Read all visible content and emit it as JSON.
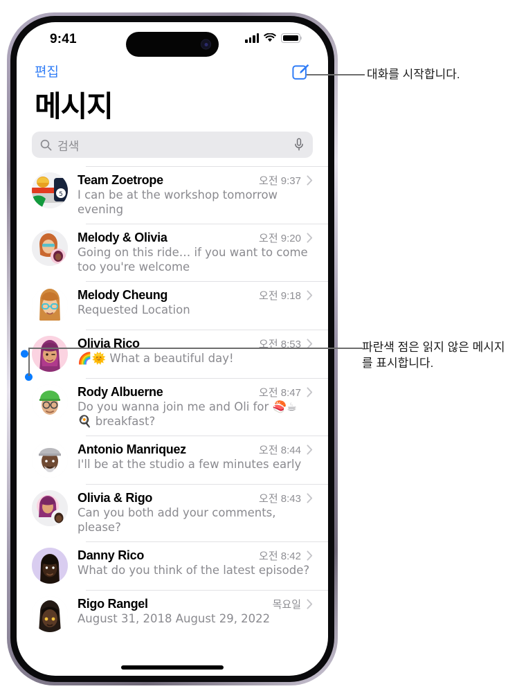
{
  "status_bar": {
    "time": "9:41",
    "signal_icon": "cellular-signal-icon",
    "wifi_icon": "wifi-icon",
    "battery_icon": "battery-icon"
  },
  "nav": {
    "edit_label": "편집",
    "compose_icon": "compose-square-pencil-icon"
  },
  "header": {
    "title": "메시지"
  },
  "search": {
    "placeholder": "검색",
    "search_icon": "search-icon",
    "mic_icon": "microphone-icon"
  },
  "conversations": [
    {
      "name": "Team Zoetrope",
      "time": "오전 9:37",
      "preview": "I can be at the workshop tomorrow evening",
      "unread": false,
      "avatar": "group-avatar-bowling"
    },
    {
      "name": "Melody & Olivia",
      "time": "오전 9:20",
      "preview": "Going on this ride… if you want to come too you're welcome",
      "unread": false,
      "avatar": "group-avatar-melody-olivia"
    },
    {
      "name": "Melody Cheung",
      "time": "오전 9:18",
      "preview": "Requested Location",
      "unread": false,
      "avatar": "memoji-melody"
    },
    {
      "name": "Olivia Rico",
      "time": "오전 8:53",
      "preview": "🌈🌞 What a beautiful day!",
      "unread": true,
      "avatar": "memoji-olivia"
    },
    {
      "name": "Rody Albuerne",
      "time": "오전 8:47",
      "preview": "Do you wanna join me and Oli for 🍣☕ 🍳 breakfast?",
      "unread": false,
      "avatar": "memoji-rody"
    },
    {
      "name": "Antonio Manriquez",
      "time": "오전 8:44",
      "preview": "I'll be at the studio a few minutes early",
      "unread": false,
      "avatar": "memoji-antonio"
    },
    {
      "name": "Olivia & Rigo",
      "time": "오전 8:43",
      "preview": "Can you both add your comments, please?",
      "unread": false,
      "avatar": "group-avatar-olivia-rigo"
    },
    {
      "name": "Danny Rico",
      "time": "오전 8:42",
      "preview": "What do you think of the latest episode?",
      "unread": false,
      "avatar": "memoji-danny"
    },
    {
      "name": "Rigo Rangel",
      "time": "목요일",
      "preview": "August 31, 2018   August 29, 2022",
      "unread": false,
      "avatar": "memoji-rigo"
    }
  ],
  "callouts": [
    {
      "id": "compose-callout",
      "text": "대화를 시작합니다."
    },
    {
      "id": "unread-dot-callout",
      "text": "파란색 점은 읽지 않은 메시지를 표시합니다."
    }
  ],
  "colors": {
    "accent_blue": "#2f7cf6",
    "unread_blue": "#0a7cff",
    "secondary_text": "#8a8a8f",
    "search_bg": "#e9e9ec"
  }
}
